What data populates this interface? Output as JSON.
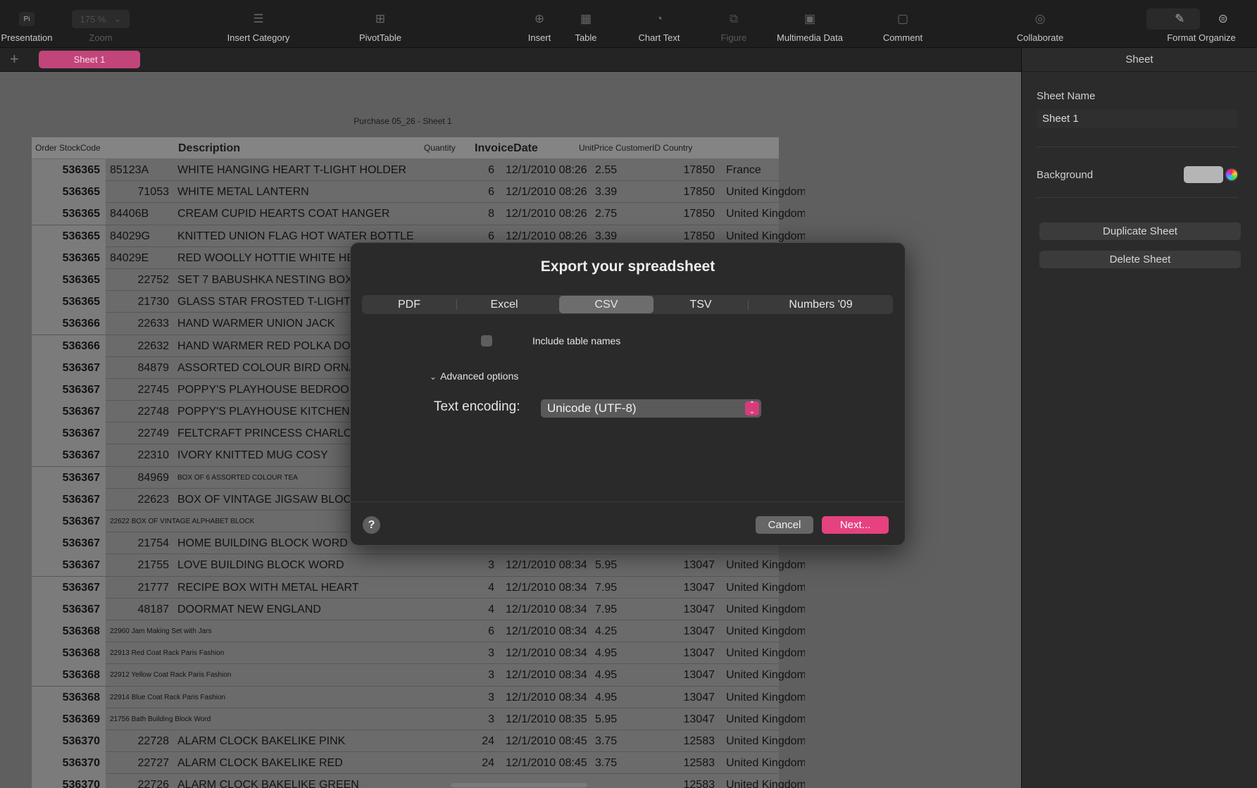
{
  "toolbar": {
    "items": [
      {
        "label": "Presentation",
        "icon": "Pi"
      },
      {
        "label": "Zoom",
        "value": "175 %"
      },
      {
        "label": "Insert Category",
        "icon": "list-icon"
      },
      {
        "label": "PivotTable",
        "icon": "pivot-icon"
      },
      {
        "label": "Insert",
        "icon": "plus-box-icon"
      },
      {
        "label": "Table",
        "icon": "table-icon"
      },
      {
        "label": "Chart Text",
        "icon": "chart-icon"
      },
      {
        "label": "Figure",
        "icon": "shape-icon"
      },
      {
        "label": "Multimedia Data",
        "icon": "image-icon"
      },
      {
        "label": "Comment",
        "icon": "comment-icon"
      },
      {
        "label": "Collaborate",
        "icon": "collaborate-icon"
      },
      {
        "label": "Format Organize",
        "icon": "brush-icon"
      }
    ]
  },
  "sheets": {
    "active": "Sheet 1"
  },
  "document": {
    "title": "Purchase 05_26 - Sheet 1"
  },
  "table": {
    "headers": {
      "order_stock": "Order StockCode",
      "description": "Description",
      "quantity": "Quantity",
      "invoice_date": "InvoiceDate",
      "price_cust_country": "UnitPrice CustomerID Country"
    },
    "rows": [
      {
        "order": "536365",
        "stock": "85123A",
        "desc": "WHITE HANGING HEART T-LIGHT HOLDER",
        "qty": "6",
        "date": "12/1/2010 08:26",
        "price": "2.55",
        "cust": "17850",
        "country": "France"
      },
      {
        "order": "536365",
        "stock": "71053",
        "desc": "WHITE METAL LANTERN",
        "qty": "6",
        "date": "12/1/2010 08:26",
        "price": "3.39",
        "cust": "17850",
        "country": "United Kingdom"
      },
      {
        "order": "536365",
        "stock": "84406B",
        "desc": "CREAM CUPID HEARTS COAT HANGER",
        "qty": "8",
        "date": "12/1/2010 08:26",
        "price": "2.75",
        "cust": "17850",
        "country": "United Kingdom"
      },
      {
        "order": "536365",
        "stock": "84029G",
        "desc": "KNITTED UNION FLAG HOT WATER BOTTLE",
        "qty": "6",
        "date": "12/1/2010 08:26",
        "price": "3.39",
        "cust": "17850",
        "country": "United Kingdom"
      },
      {
        "order": "536365",
        "stock": "84029E",
        "desc": "RED WOOLLY HOTTIE WHITE HEART.",
        "qty": "",
        "date": "",
        "price": "",
        "cust": "",
        "country": ""
      },
      {
        "order": "536365",
        "stock": "22752",
        "desc": "SET 7 BABUSHKA NESTING BOXES",
        "qty": "",
        "date": "",
        "price": "",
        "cust": "",
        "country": ""
      },
      {
        "order": "536365",
        "stock": "21730",
        "desc": "GLASS STAR FROSTED T-LIGHT HOLDER",
        "qty": "",
        "date": "",
        "price": "",
        "cust": "",
        "country": ""
      },
      {
        "order": "536366",
        "stock": "22633",
        "desc": "HAND WARMER UNION JACK",
        "qty": "",
        "date": "",
        "price": "",
        "cust": "",
        "country": ""
      },
      {
        "order": "536366",
        "stock": "22632",
        "desc": "HAND WARMER RED POLKA DOT",
        "qty": "",
        "date": "",
        "price": "",
        "cust": "",
        "country": ""
      },
      {
        "order": "536367",
        "stock": "84879",
        "desc": "ASSORTED COLOUR BIRD ORNAMENT",
        "qty": "",
        "date": "",
        "price": "",
        "cust": "",
        "country": ""
      },
      {
        "order": "536367",
        "stock": "22745",
        "desc": "POPPY'S PLAYHOUSE BEDROOM",
        "qty": "",
        "date": "",
        "price": "",
        "cust": "",
        "country": ""
      },
      {
        "order": "536367",
        "stock": "22748",
        "desc": "POPPY'S PLAYHOUSE KITCHEN",
        "qty": "",
        "date": "",
        "price": "",
        "cust": "",
        "country": ""
      },
      {
        "order": "536367",
        "stock": "22749",
        "desc": "FELTCRAFT PRINCESS CHARLOTTE DOLL",
        "qty": "",
        "date": "",
        "price": "",
        "cust": "",
        "country": ""
      },
      {
        "order": "536367",
        "stock": "22310",
        "desc": "IVORY KNITTED MUG COSY",
        "qty": "",
        "date": "",
        "price": "",
        "cust": "",
        "country": ""
      },
      {
        "order": "536367",
        "stock": "84969",
        "desc": "BOX OF 6 ASSORTED COLOUR TEA",
        "qty": "",
        "date": "",
        "price": "",
        "cust": "",
        "country": "",
        "small_desc": true
      },
      {
        "order": "536367",
        "stock": "22623",
        "desc": "BOX OF VINTAGE JIGSAW BLOCKS",
        "qty": "",
        "date": "",
        "price": "",
        "cust": "",
        "country": ""
      },
      {
        "order": "536367",
        "stock": "22622 BOX OF VINTAGE ALPHABET BLOCK",
        "desc": "",
        "qty": "",
        "date": "",
        "price": "",
        "cust": "",
        "country": "",
        "merged_small": true
      },
      {
        "order": "536367",
        "stock": "21754",
        "desc": "HOME BUILDING BLOCK WORD",
        "qty": "",
        "date": "",
        "price": "",
        "cust": "",
        "country": ""
      },
      {
        "order": "536367",
        "stock": "21755",
        "desc": "LOVE BUILDING BLOCK WORD",
        "qty": "3",
        "date": "12/1/2010 08:34",
        "price": "5.95",
        "cust": "13047",
        "country": "United Kingdom"
      },
      {
        "order": "536367",
        "stock": "21777",
        "desc": "RECIPE BOX WITH METAL HEART",
        "qty": "4",
        "date": "12/1/2010 08:34",
        "price": "7.95",
        "cust": "13047",
        "country": "United Kingdom"
      },
      {
        "order": "536367",
        "stock": "48187",
        "desc": "DOORMAT NEW ENGLAND",
        "qty": "4",
        "date": "12/1/2010 08:34",
        "price": "7.95",
        "cust": "13047",
        "country": "United Kingdom"
      },
      {
        "order": "536368",
        "stock": "22960 Jam Making Set with Jars",
        "desc": "",
        "qty": "6",
        "date": "12/1/2010 08:34",
        "price": "4.25",
        "cust": "13047",
        "country": "United Kingdom",
        "merged_small": true
      },
      {
        "order": "536368",
        "stock": "22913 Red Coat Rack Paris Fashion",
        "desc": "",
        "qty": "3",
        "date": "12/1/2010 08:34",
        "price": "4.95",
        "cust": "13047",
        "country": "United Kingdom",
        "merged_small": true
      },
      {
        "order": "536368",
        "stock": "22912 Yellow Coat Rack Paris Fashion",
        "desc": "",
        "qty": "3",
        "date": "12/1/2010 08:34",
        "price": "4.95",
        "cust": "13047",
        "country": "United Kingdom",
        "merged_small": true
      },
      {
        "order": "536368",
        "stock": "22914 Blue Coat Rack Paris Fashion",
        "desc": "",
        "qty": "3",
        "date": "12/1/2010 08:34",
        "price": "4.95",
        "cust": "13047",
        "country": "United Kingdom",
        "merged_small": true
      },
      {
        "order": "536369",
        "stock": "21756 Bath Building Block Word",
        "desc": "",
        "qty": "3",
        "date": "12/1/2010 08:35",
        "price": "5.95",
        "cust": "13047",
        "country": "United Kingdom",
        "merged_small": true
      },
      {
        "order": "536370",
        "stock": "22728",
        "desc": "ALARM CLOCK BAKELIKE PINK",
        "qty": "24",
        "date": "12/1/2010 08:45",
        "price": "3.75",
        "cust": "12583",
        "country": "United Kingdom"
      },
      {
        "order": "536370",
        "stock": "22727",
        "desc": "ALARM CLOCK BAKELIKE RED",
        "qty": "24",
        "date": "12/1/2010 08:45",
        "price": "3.75",
        "cust": "12583",
        "country": "United Kingdom"
      },
      {
        "order": "536370",
        "stock": "22726",
        "desc": "ALARM CLOCK BAKELIKE GREEN",
        "qty": "",
        "date": "",
        "price": "",
        "cust": "12583",
        "country": "United Kingdom"
      }
    ]
  },
  "inspector": {
    "header": "Sheet",
    "sheet_name_label": "Sheet Name",
    "sheet_name_value": "Sheet 1",
    "background_label": "Background",
    "duplicate_button": "Duplicate Sheet",
    "delete_button": "Delete Sheet"
  },
  "dialog": {
    "title": "Export your spreadsheet",
    "formats": [
      "PDF",
      "Excel",
      "CSV",
      "TSV",
      "Numbers '09"
    ],
    "active_format": "CSV",
    "include_table_names": "Include table names",
    "include_table_names_checked": false,
    "advanced_options": "Advanced options",
    "text_encoding_label": "Text encoding:",
    "text_encoding_value": "Unicode (UTF-8)",
    "help": "?",
    "cancel": "Cancel",
    "next": "Next..."
  },
  "colors": {
    "accent": "#e5427f",
    "sheet_tab": "#c2457a"
  }
}
